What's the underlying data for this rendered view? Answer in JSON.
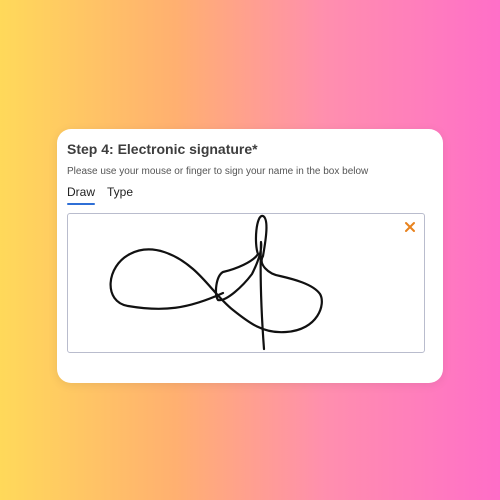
{
  "signature_step": {
    "title": "Step 4: Electronic signature*",
    "instructions": "Please use your mouse or finger to sign your name in the box below",
    "tabs": [
      {
        "label": "Draw",
        "active": true
      },
      {
        "label": "Type",
        "active": false
      }
    ],
    "clear_icon": "close-icon",
    "colors": {
      "accent": "#2f6fd6",
      "clear_icon": "#e8821e",
      "ink": "#111111",
      "box_border": "#b9bccd"
    }
  }
}
